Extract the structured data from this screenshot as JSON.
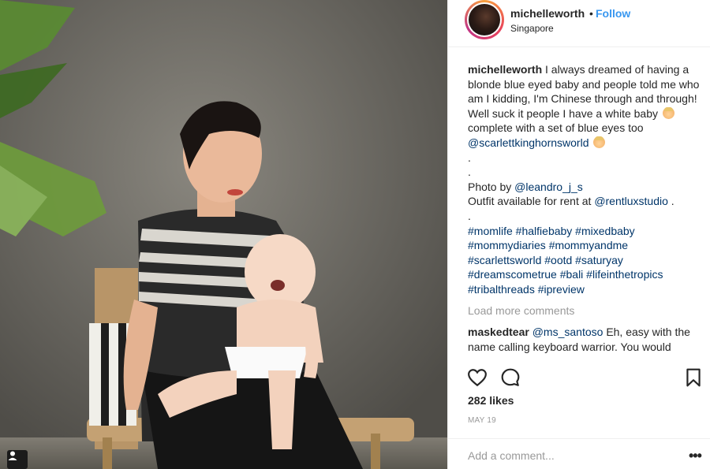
{
  "post": {
    "username": "michelleworth",
    "separator": "•",
    "follow_label": "Follow",
    "location": "Singapore"
  },
  "caption": {
    "username": "michelleworth",
    "text_1": "I always dreamed of having a blonde blue eyed baby and people told me who am I kidding, I'm Chinese through and through! Well suck it people I have a white baby",
    "text_2": "complete with a set of blue eyes too",
    "mention_1": "@scarlettkinghornsworld",
    "dot_1": ".",
    "dot_2": ".",
    "photo_by": "Photo by",
    "mention_2": "@leandro_j_s",
    "outfit": "Outfit available for rent at",
    "mention_3": "@rentluxstudio",
    "trailing_dot": ".",
    "dot_3": ".",
    "hashtags": "#momlife #halfiebaby #mixedbaby #mommydiaries #mommyandme #scarlettsworld #ootd #saturyay #dreamscometrue #bali #lifeinthetropics #tribalthreads #ipreview"
  },
  "load_more": "Load more comments",
  "comment": {
    "username": "maskedtear",
    "mention": "@ms_santoso",
    "text": "Eh, easy with the name calling keyboard warrior. You would"
  },
  "icons": {
    "like": "heart-icon",
    "comment": "comment-icon",
    "save": "bookmark-icon",
    "tag": "user-tag-icon"
  },
  "likes": "282 likes",
  "date": "MAY 19",
  "add_comment_placeholder": "Add a comment...",
  "more_label": "•••",
  "colors": {
    "link": "#003569",
    "follow": "#3897f0",
    "muted": "#999999"
  }
}
